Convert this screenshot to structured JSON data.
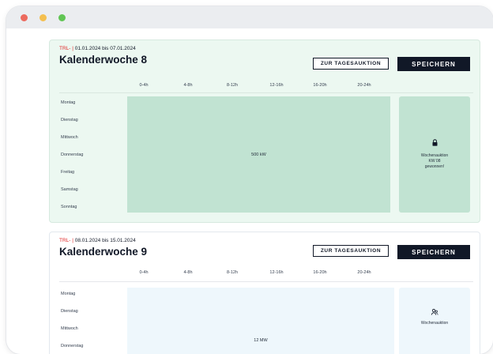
{
  "window": {
    "controls": [
      "close",
      "minimize",
      "maximize"
    ]
  },
  "weeks": [
    {
      "tag": "TRL- |",
      "range": "01.01.2024 bis 07.01.2024",
      "title": "Kalenderwoche 8",
      "day_ahead_label": "ZUR TAGESAUKTION",
      "save_label": "SPEICHERN",
      "hours": [
        "0-4h",
        "4-8h",
        "8-12h",
        "12-16h",
        "16-20h",
        "20-24h"
      ],
      "days": [
        "Montag",
        "Dienstag",
        "Mittwoch",
        "Donnerstag",
        "Freitag",
        "Samstag",
        "Sonntag"
      ],
      "block_value": "500 kW",
      "side": {
        "icon": "lock-icon",
        "line1": "Wochenauktion",
        "line2": "KW 08",
        "line3": "gewonnen!"
      },
      "colors": {
        "background": "#ecf8f1",
        "block": "#c1e3d2"
      }
    },
    {
      "tag": "TRL- |",
      "range": "08.01.2024 bis 15.01.2024",
      "title": "Kalenderwoche 9",
      "day_ahead_label": "ZUR TAGESAUKTION",
      "save_label": "SPEICHERN",
      "hours": [
        "0-4h",
        "4-8h",
        "8-12h",
        "12-16h",
        "16-20h",
        "20-24h"
      ],
      "days": [
        "Montag",
        "Dienstag",
        "Mittwoch",
        "Donnerstag"
      ],
      "block_value": "12 MW",
      "side": {
        "icon": "people-icon",
        "line1": "Wochenauktion"
      },
      "colors": {
        "background": "#ffffff",
        "block": "#eef7fc"
      }
    }
  ],
  "colors": {
    "accent_red": "#e02424",
    "button_dark": "#111827"
  }
}
